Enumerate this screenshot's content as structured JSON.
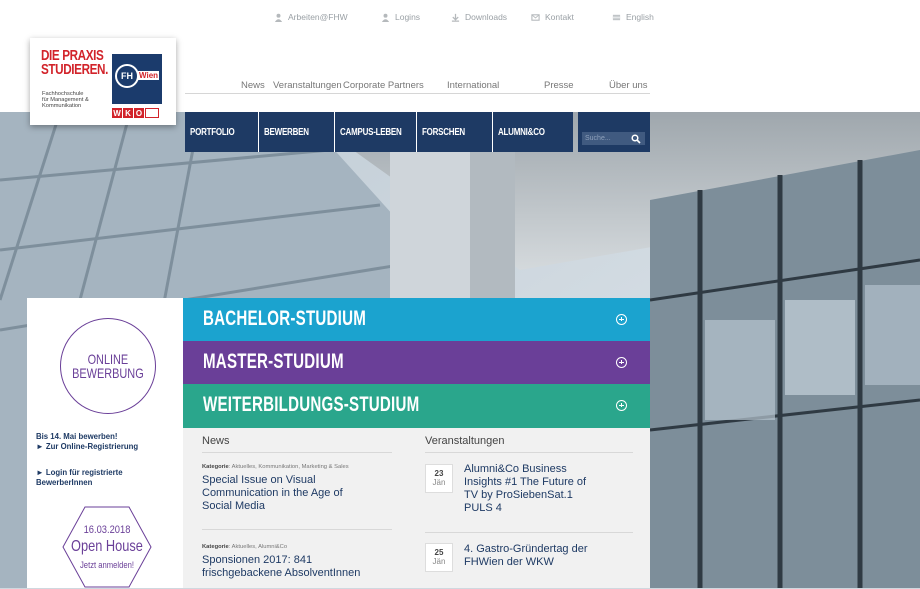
{
  "utility_nav": [
    {
      "label": "Arbeiten@FHW",
      "icon": "person-icon"
    },
    {
      "label": "Logins",
      "icon": "person-icon"
    },
    {
      "label": "Downloads",
      "icon": "download-icon"
    },
    {
      "label": "Kontakt",
      "icon": "contact-icon"
    },
    {
      "label": "English",
      "icon": "flag-icon"
    }
  ],
  "logo": {
    "line1": "DIE PRAXIS",
    "line2": "STUDIEREN.",
    "sub1": "Fachhochschule",
    "sub2": "für Management &",
    "sub3": "Kommunikation",
    "fh": "FH",
    "wien": "Wien",
    "wko_w": "W",
    "wko_k": "K",
    "wko_o": "O"
  },
  "main_nav": [
    "News",
    "Veranstaltungen",
    "Corporate Partners",
    "International",
    "Presse",
    "Über uns"
  ],
  "blue_nav": [
    "PORTFOLIO",
    "BEWERBEN",
    "CAMPUS-LEBEN",
    "FORSCHEN",
    "ALUMNI&CO"
  ],
  "search": {
    "placeholder": "Suche..."
  },
  "left_panel": {
    "online_line1": "ONLINE",
    "online_line2": "BEWERBUNG",
    "deadline": "Bis 14. Mai bewerben!",
    "online_link": "► Zur Online-Registrierung",
    "login_link_1": "► Login für registrierte",
    "login_link_2": "BewerberInnen",
    "openhouse_date": "16.03.2018",
    "openhouse_title": "Open House",
    "openhouse_cta": "Jetzt anmelden!"
  },
  "programs": [
    {
      "label": "BACHELOR-STUDIUM",
      "color": "#1ba3cf"
    },
    {
      "label": "MASTER-STUDIUM",
      "color": "#6a3f98"
    },
    {
      "label": "WEITERBILDUNGS-STUDIUM",
      "color": "#2aa68c"
    }
  ],
  "news": {
    "heading": "News",
    "items": [
      {
        "cat_label": "Kategorie",
        "cat_values": ": Aktuelles, Kommunikation, Marketing & Sales",
        "title_1": "Special Issue on Visual",
        "title_2": "Communication in the Age of",
        "title_3": "Social Media"
      },
      {
        "cat_label": "Kategorie",
        "cat_values": ": Aktuelles, Alumni&Co",
        "title_1": "Sponsionen 2017: 841",
        "title_2": "frischgebackene AbsolventInnen"
      }
    ]
  },
  "events": {
    "heading": "Veranstaltungen",
    "items": [
      {
        "day": "23",
        "month": "Jän",
        "title_1": "Alumni&Co Business",
        "title_2": "Insights #1 The Future of",
        "title_3": "TV by ProSiebenSat.1",
        "title_4": "PULS 4"
      },
      {
        "day": "25",
        "month": "Jän",
        "title_1": "4. Gastro-Gründertag der",
        "title_2": "FHWien der WKW"
      }
    ]
  },
  "colors": {
    "navy": "#1e3a64",
    "purple": "#6a3f98",
    "red": "#d2232a"
  }
}
